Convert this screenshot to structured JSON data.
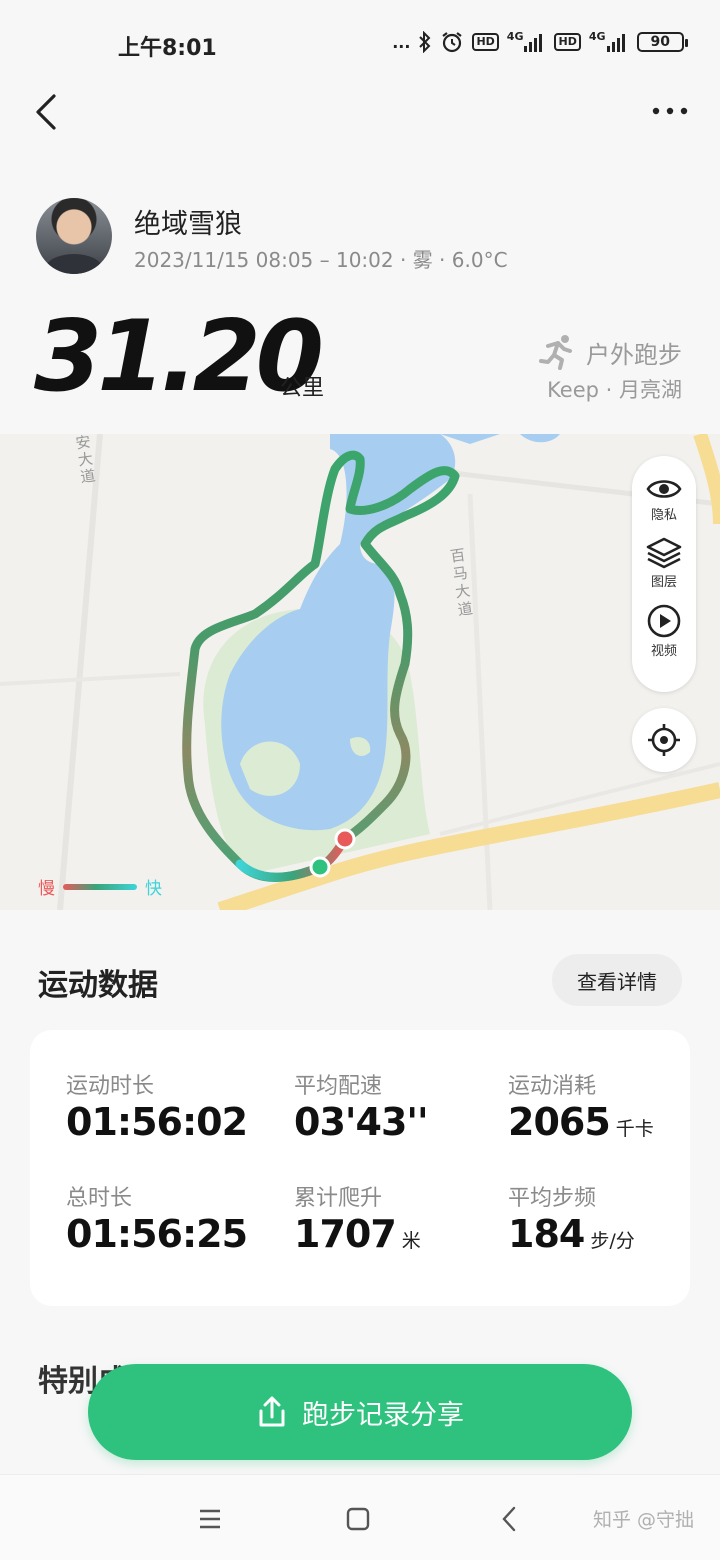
{
  "status_bar": {
    "time": "上午8:01",
    "dots": "...",
    "hd1": "HD",
    "sig1": "4G",
    "hd2": "HD",
    "sig2": "4G",
    "battery": "90"
  },
  "user": {
    "name": "绝域雪狼",
    "meta": "2023/11/15 08:05 – 10:02 · 雾 · 6.0°C"
  },
  "summary": {
    "distance": "31.20",
    "distance_unit": "公里",
    "sport_type": "户外跑步",
    "source": "Keep · 月亮湖"
  },
  "map": {
    "road_labels": [
      "安大道",
      "百马大道"
    ],
    "controls": [
      {
        "label": "隐私",
        "icon": "eye-icon"
      },
      {
        "label": "图层",
        "icon": "layers-icon"
      },
      {
        "label": "视频",
        "icon": "play-icon"
      }
    ],
    "legend": {
      "slow": "慢",
      "fast": "快"
    },
    "colors": {
      "slow": "#e85a5a",
      "mid": "#3aa47a",
      "fast": "#3ed4d8",
      "water": "#a7cdf0",
      "park": "#dcebd3",
      "road": "#f7dc94"
    }
  },
  "section": {
    "title": "运动数据",
    "detail_button": "查看详情",
    "next_title": "特别成就"
  },
  "stats": [
    {
      "label": "运动时长",
      "value": "01:56:02",
      "unit": ""
    },
    {
      "label": "平均配速",
      "value": "03'43''",
      "unit": ""
    },
    {
      "label": "运动消耗",
      "value": "2065",
      "unit": "千卡"
    },
    {
      "label": "总时长",
      "value": "01:56:25",
      "unit": ""
    },
    {
      "label": "累计爬升",
      "value": "1707",
      "unit": "米"
    },
    {
      "label": "平均步频",
      "value": "184",
      "unit": "步/分"
    }
  ],
  "share_button": "跑步记录分享",
  "watermark": "知乎 @守拙",
  "accent_color": "#2ec27e"
}
